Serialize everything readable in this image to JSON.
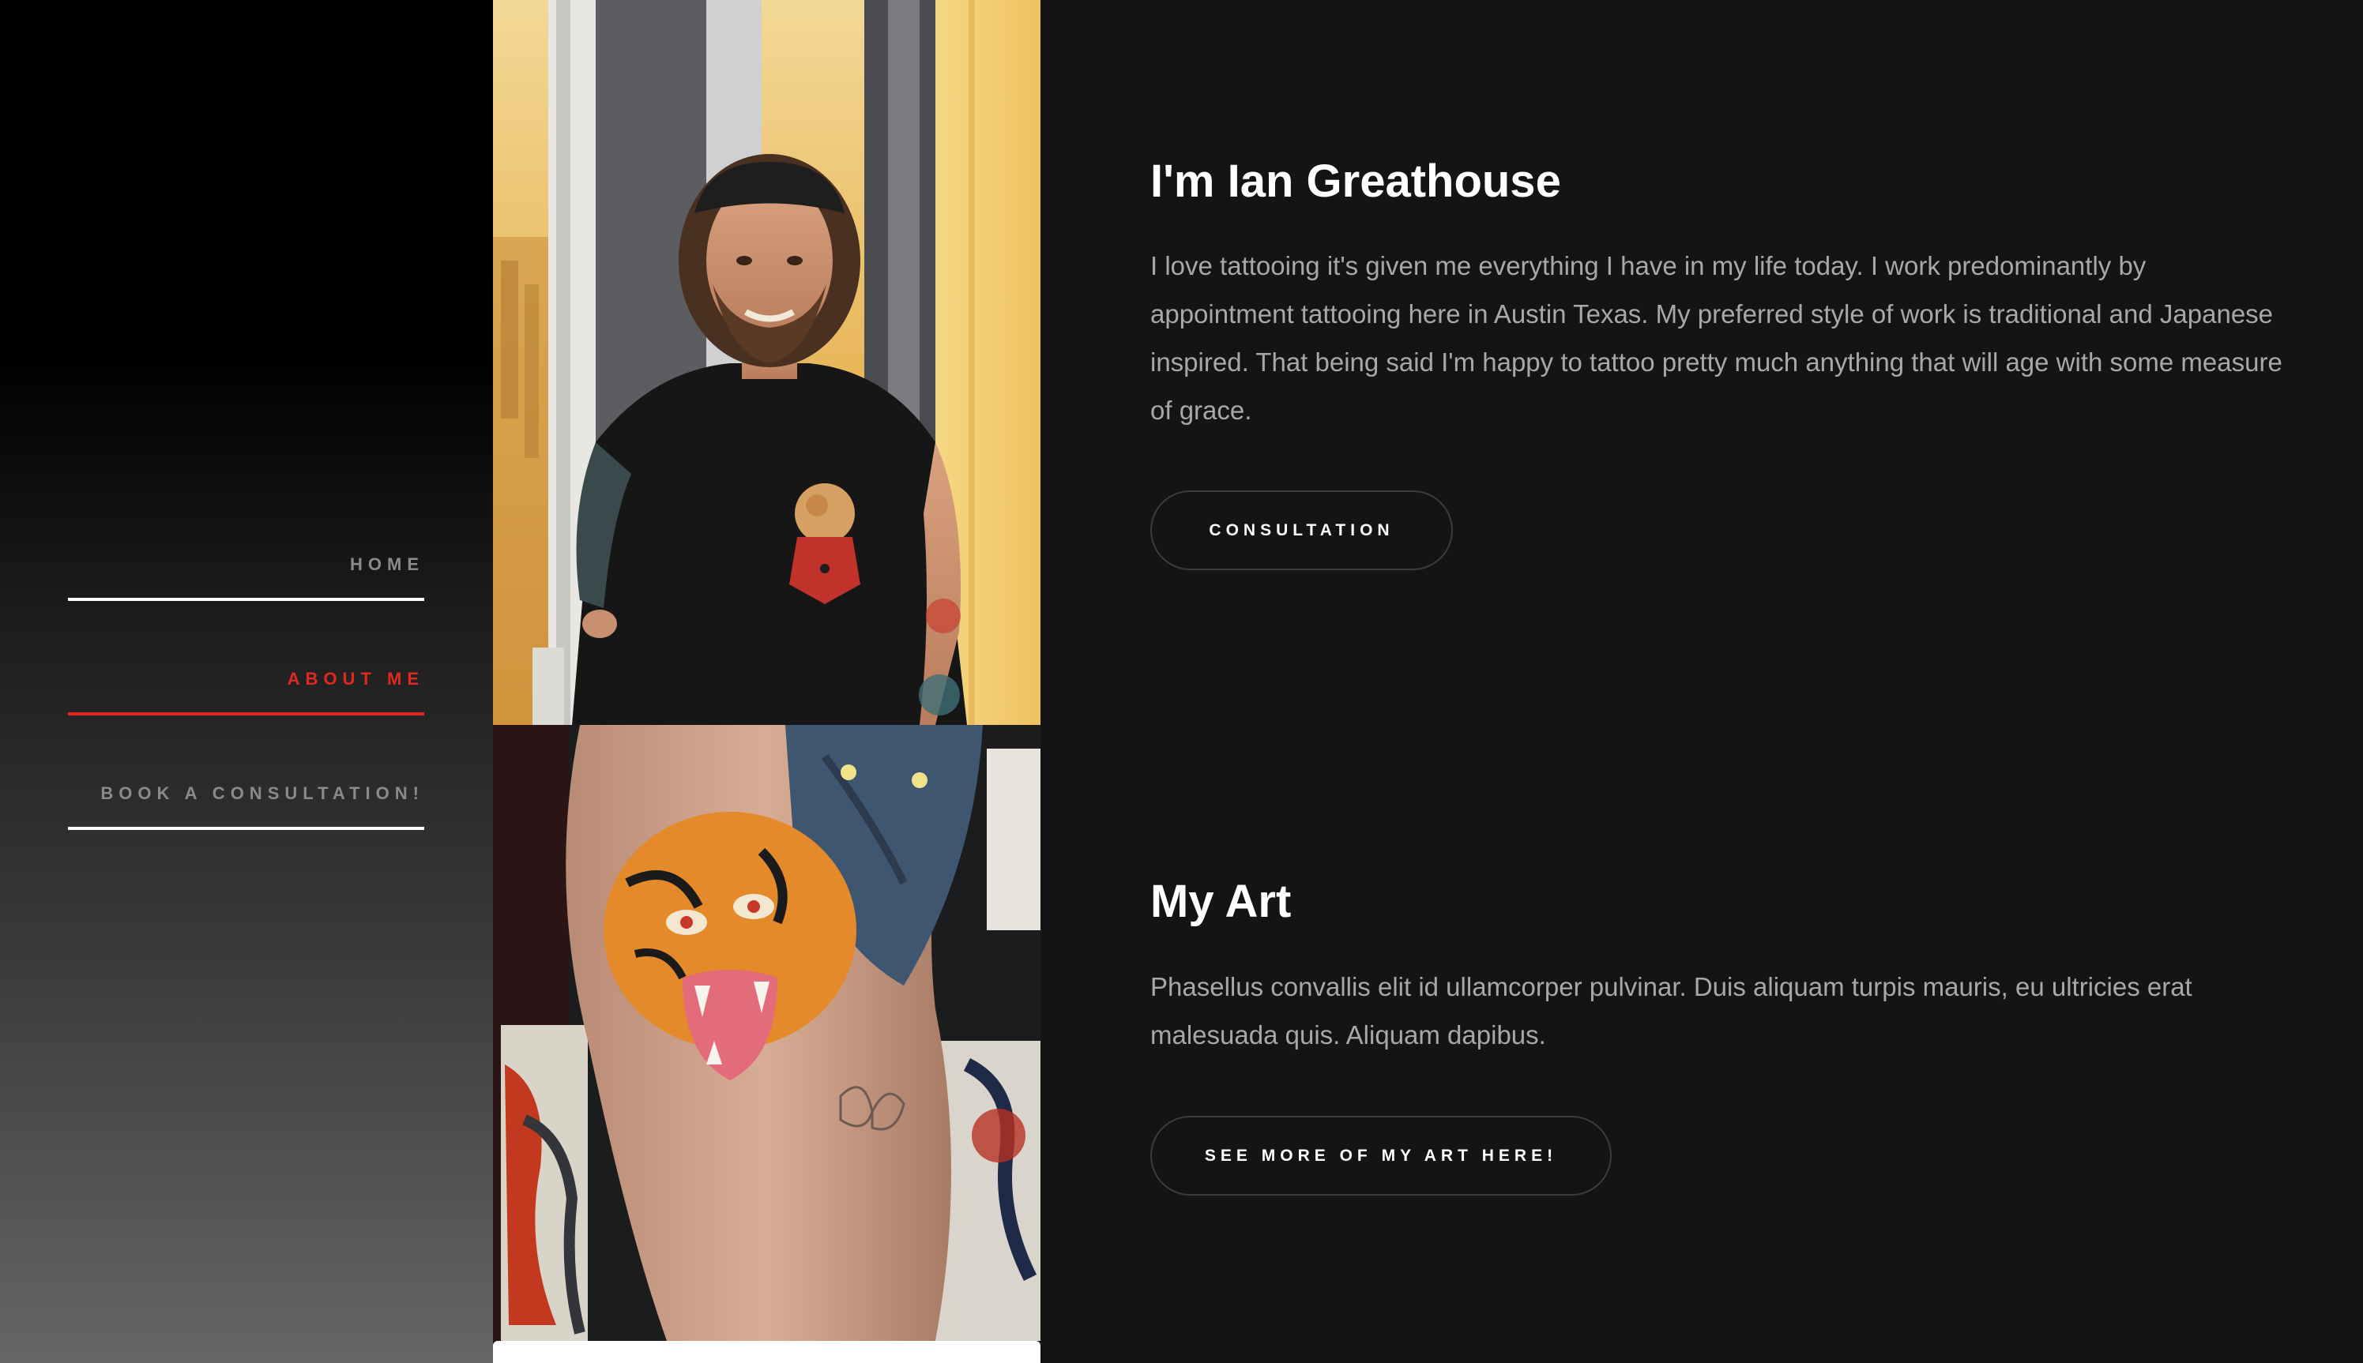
{
  "nav": {
    "items": [
      {
        "label": "HOME",
        "active": false
      },
      {
        "label": "ABOUT ME",
        "active": true
      },
      {
        "label": "BOOK A CONSULTATION!",
        "active": false
      }
    ],
    "active_color": "#e0281e"
  },
  "about": {
    "title": "I'm Ian Greathouse",
    "body": "I love tattooing it's given me everything I have in my life today. I work predominantly by appointment tattooing here in Austin Texas. My preferred style of work is traditional and Japanese inspired. That being said I'm happy to tattoo pretty much anything that will age with some measure of grace.",
    "button_label": "CONSULTATION"
  },
  "art": {
    "title": "My Art",
    "body": "Phasellus convallis elit id ullamcorper pulvinar. Duis aliquam turpis mauris, eu ultricies erat malesuada quis. Aliquam dapibus.",
    "button_label": "SEE MORE OF MY ART HERE!"
  },
  "photos": {
    "portrait": "portrait-photo",
    "tattoo": "tiger-tattoo-photo"
  },
  "colors": {
    "page_bg": "#141414",
    "text_muted": "#a8a8a8",
    "accent": "#e0281e"
  }
}
